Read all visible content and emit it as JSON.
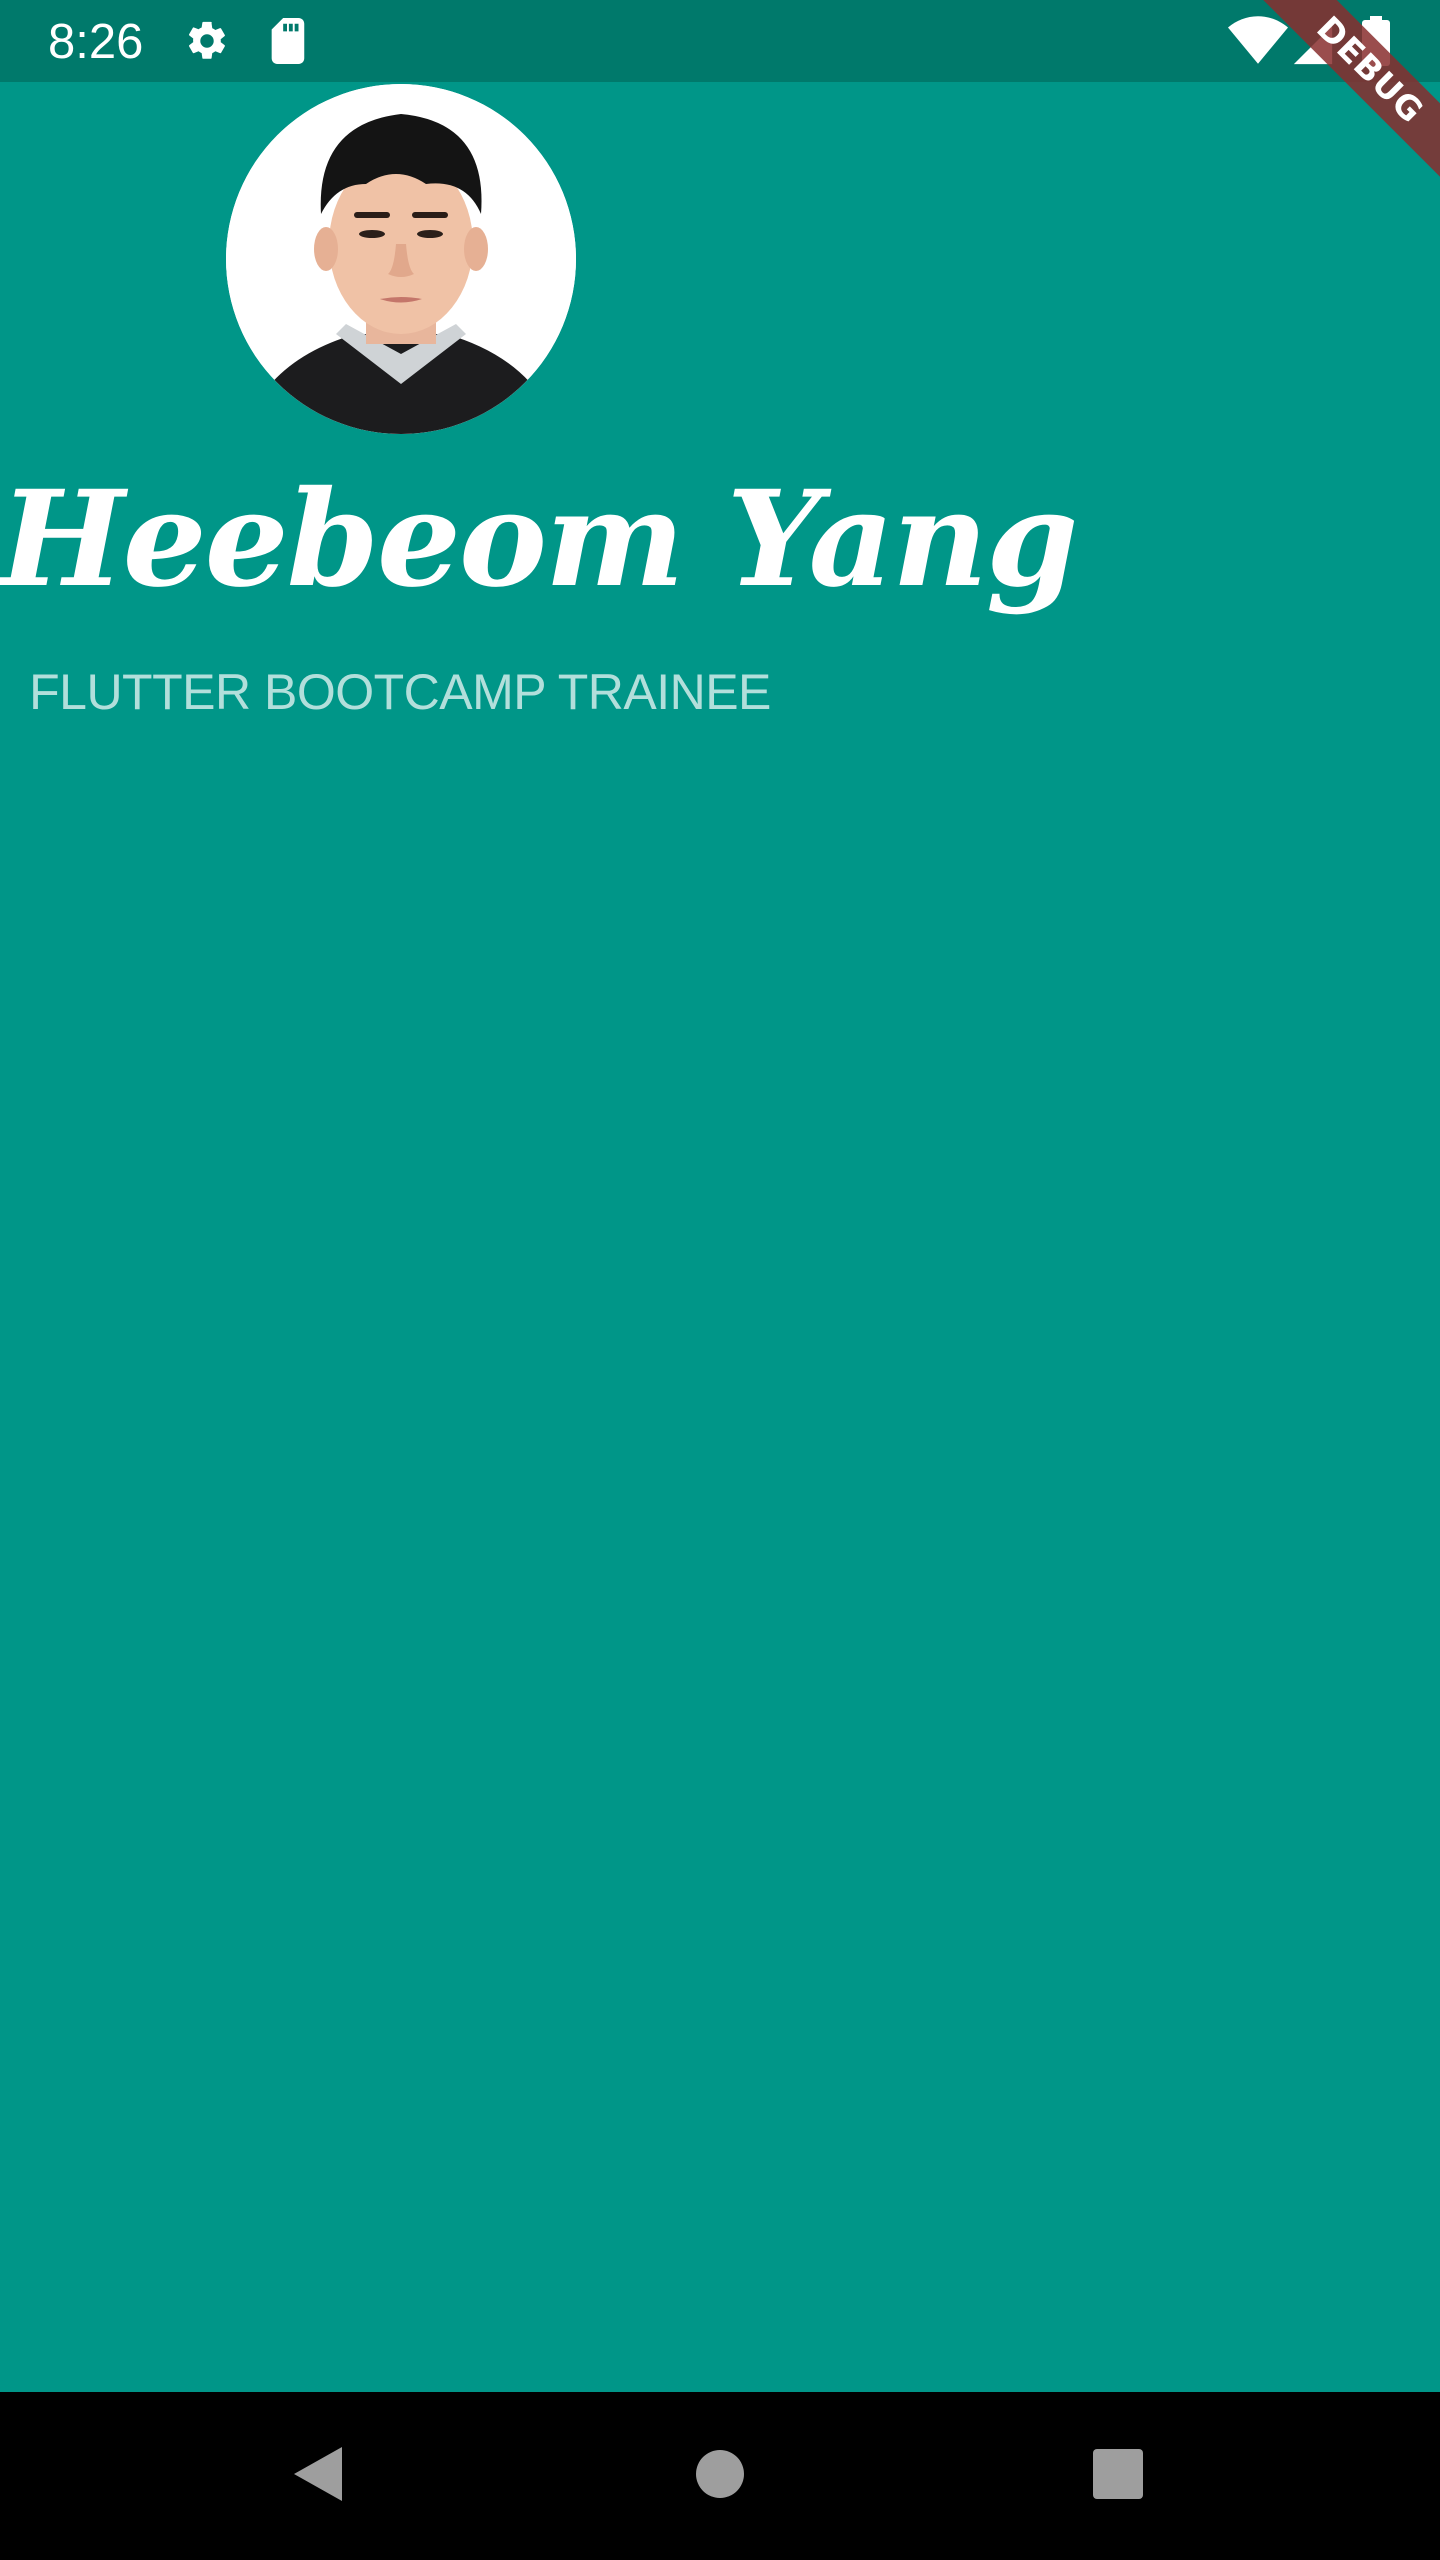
{
  "status_bar": {
    "time": "8:26",
    "left_icons": [
      "settings-icon",
      "sd-card-icon"
    ],
    "right_icons": [
      "wifi-icon",
      "cell-signal-icon",
      "battery-icon"
    ]
  },
  "debug_banner": {
    "label": "DEBUG"
  },
  "profile": {
    "avatar": "profile-photo",
    "name": "Heebeom Yang",
    "role": "FLUTTER BOOTCAMP TRAINEE"
  },
  "nav_bar": {
    "buttons": [
      "back-icon",
      "home-icon",
      "recents-icon"
    ]
  },
  "colors": {
    "background": "#009688",
    "status_bar": "#00796b",
    "name_text": "#ffffff",
    "role_text": "#b2dfdb",
    "debug_banner": "#882e2e",
    "nav_bar": "#000000"
  }
}
